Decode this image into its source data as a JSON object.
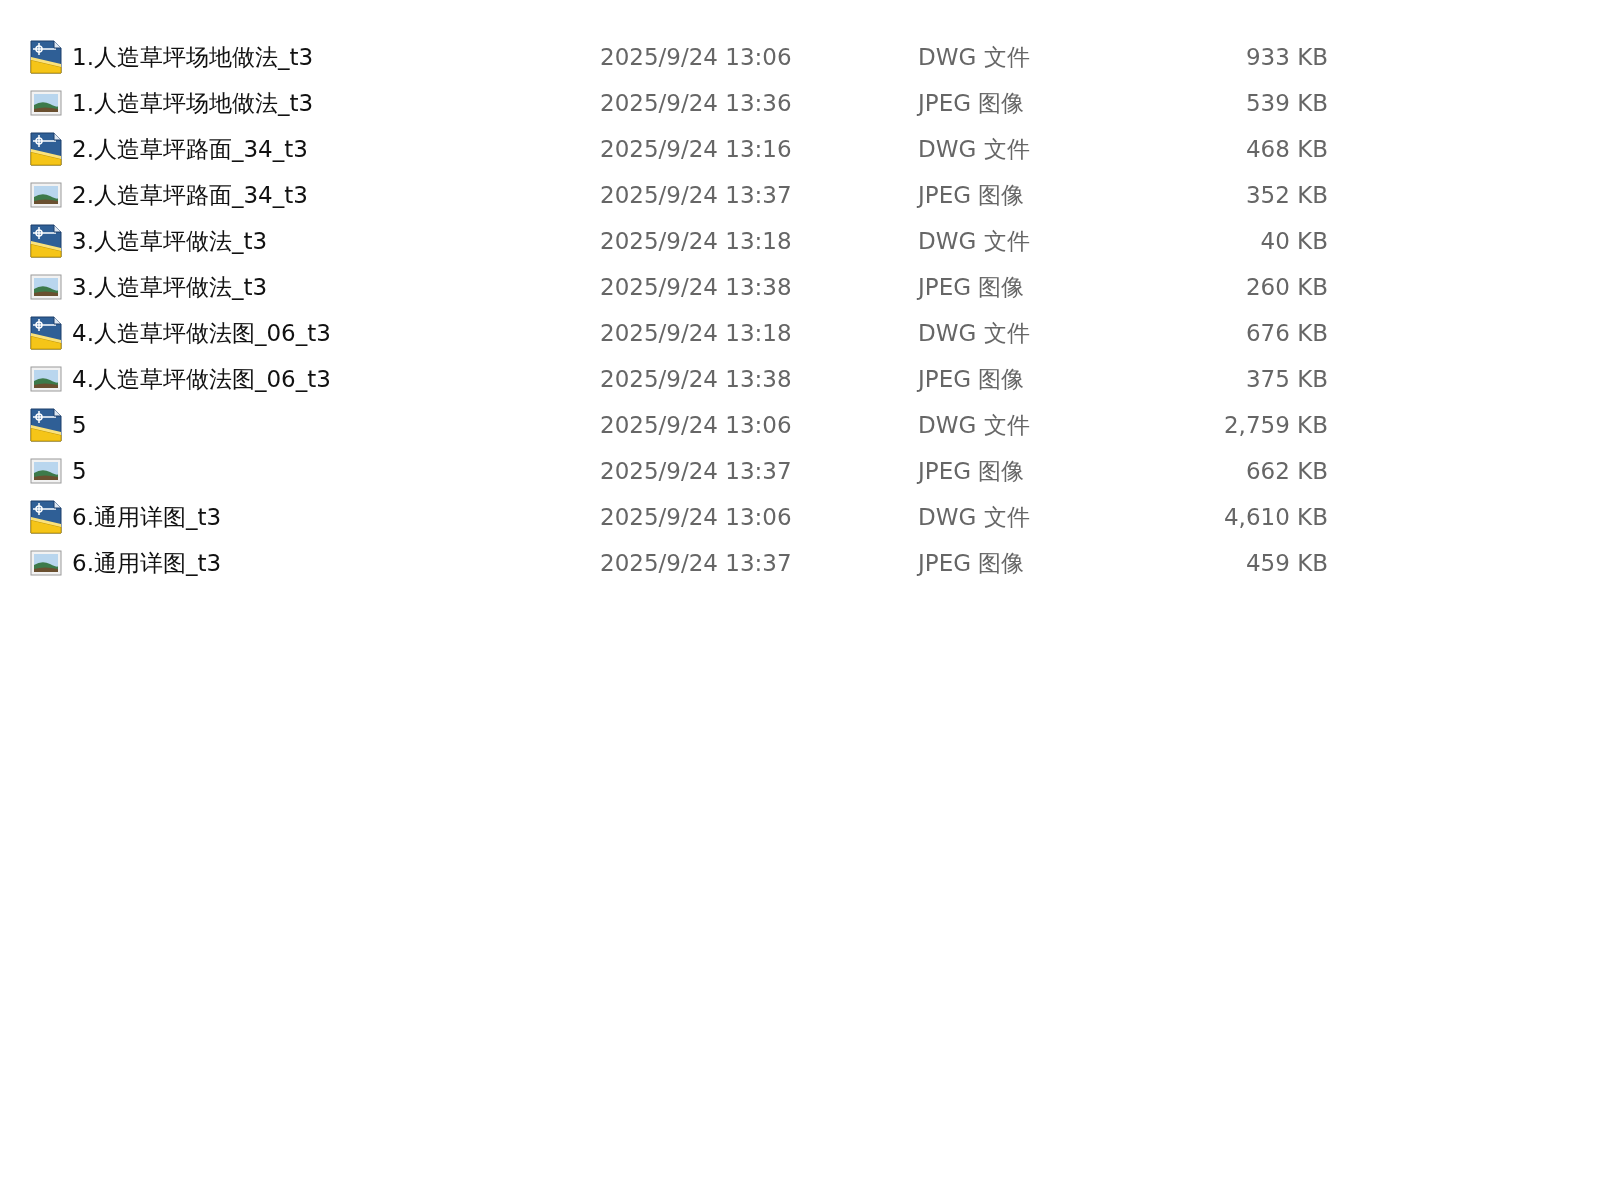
{
  "files": [
    {
      "kind": "dwg",
      "name": "1.人造草坪场地做法_t3",
      "modified": "2025/9/24 13:06",
      "type": "DWG 文件",
      "size": "933 KB"
    },
    {
      "kind": "jpeg",
      "name": "1.人造草坪场地做法_t3",
      "modified": "2025/9/24 13:36",
      "type": "JPEG 图像",
      "size": "539 KB"
    },
    {
      "kind": "dwg",
      "name": "2.人造草坪路面_34_t3",
      "modified": "2025/9/24 13:16",
      "type": "DWG 文件",
      "size": "468 KB"
    },
    {
      "kind": "jpeg",
      "name": "2.人造草坪路面_34_t3",
      "modified": "2025/9/24 13:37",
      "type": "JPEG 图像",
      "size": "352 KB"
    },
    {
      "kind": "dwg",
      "name": "3.人造草坪做法_t3",
      "modified": "2025/9/24 13:18",
      "type": "DWG 文件",
      "size": "40 KB"
    },
    {
      "kind": "jpeg",
      "name": "3.人造草坪做法_t3",
      "modified": "2025/9/24 13:38",
      "type": "JPEG 图像",
      "size": "260 KB"
    },
    {
      "kind": "dwg",
      "name": "4.人造草坪做法图_06_t3",
      "modified": "2025/9/24 13:18",
      "type": "DWG 文件",
      "size": "676 KB"
    },
    {
      "kind": "jpeg",
      "name": "4.人造草坪做法图_06_t3",
      "modified": "2025/9/24 13:38",
      "type": "JPEG 图像",
      "size": "375 KB"
    },
    {
      "kind": "dwg",
      "name": "5",
      "modified": "2025/9/24 13:06",
      "type": "DWG 文件",
      "size": "2,759 KB"
    },
    {
      "kind": "jpeg",
      "name": "5",
      "modified": "2025/9/24 13:37",
      "type": "JPEG 图像",
      "size": "662 KB"
    },
    {
      "kind": "dwg",
      "name": "6.通用详图_t3",
      "modified": "2025/9/24 13:06",
      "type": "DWG 文件",
      "size": "4,610 KB"
    },
    {
      "kind": "jpeg",
      "name": "6.通用详图_t3",
      "modified": "2025/9/24 13:37",
      "type": "JPEG 图像",
      "size": "459 KB"
    }
  ]
}
